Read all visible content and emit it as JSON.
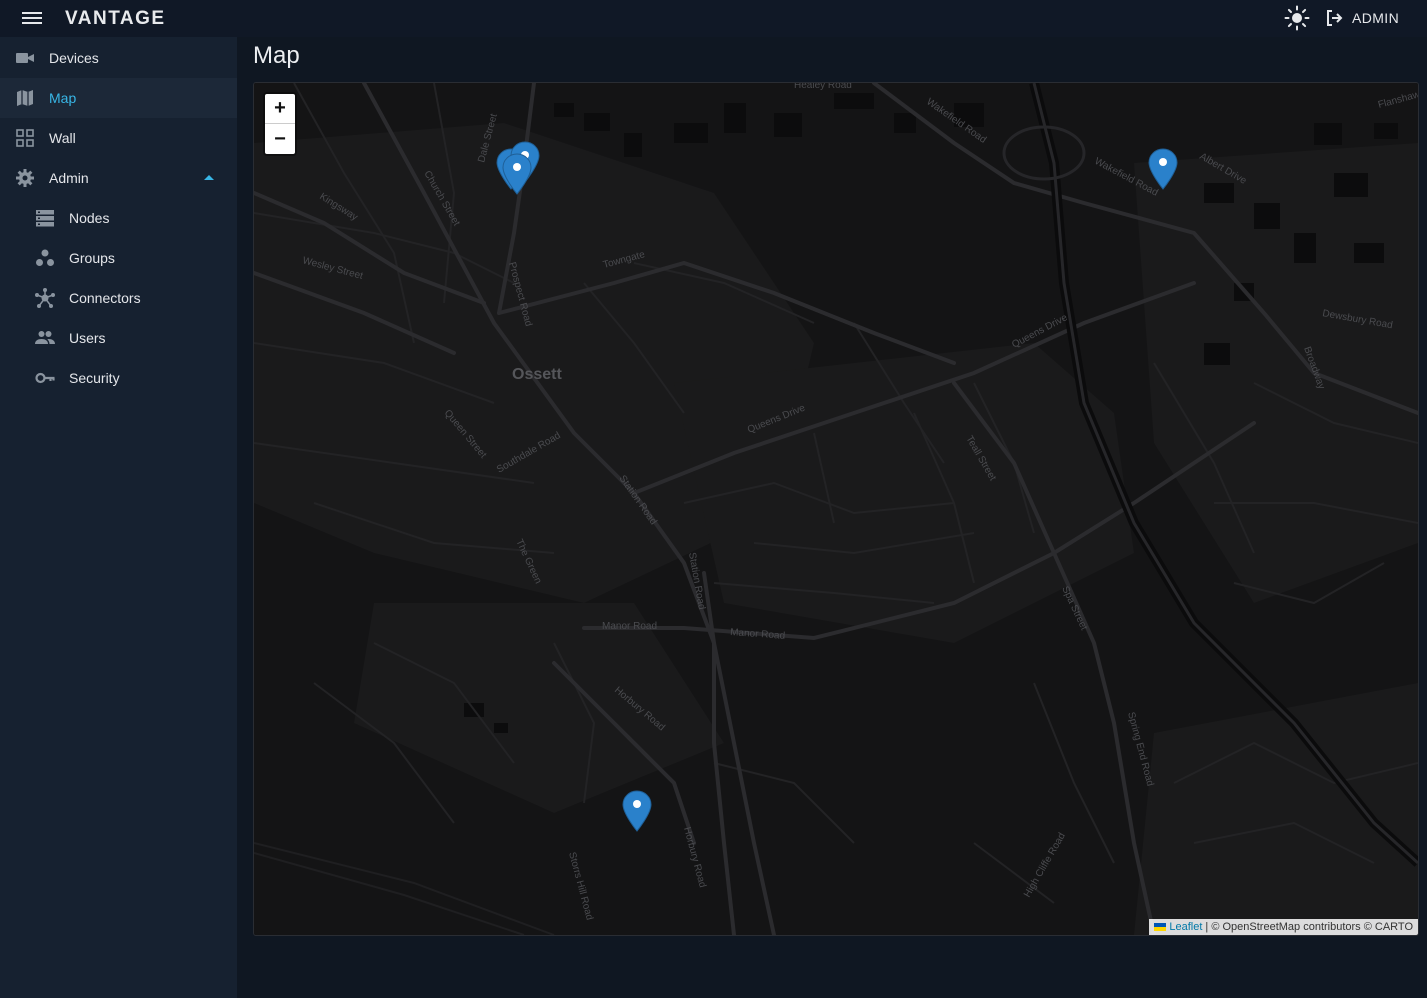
{
  "app": {
    "brand": "VANTAGE"
  },
  "header": {
    "user_label": "ADMIN"
  },
  "sidebar": {
    "items": [
      {
        "label": "Devices",
        "icon": "video-camera-icon"
      },
      {
        "label": "Map",
        "icon": "map-icon",
        "active": true
      },
      {
        "label": "Wall",
        "icon": "grid-icon"
      },
      {
        "label": "Admin",
        "icon": "gear-icon",
        "expanded": true
      },
      {
        "label": "Nodes",
        "icon": "server-icon"
      },
      {
        "label": "Groups",
        "icon": "group-nodes-icon"
      },
      {
        "label": "Connectors",
        "icon": "hub-icon"
      },
      {
        "label": "Users",
        "icon": "people-icon"
      },
      {
        "label": "Security",
        "icon": "key-icon"
      }
    ]
  },
  "page": {
    "title": "Map"
  },
  "map": {
    "zoom_in": "+",
    "zoom_out": "−",
    "place_label": "Ossett",
    "streets": [
      "Wakefield Road",
      "Queens Drive",
      "Station Road",
      "Manor Road",
      "Towngate",
      "Dewsbury Road",
      "Prospect Road",
      "Church Street",
      "Dale Street",
      "Kingsway",
      "Wesley Street",
      "Queen Street",
      "Southdale Road",
      "The Green",
      "Horbury Road",
      "Spa Street",
      "Spring End Road",
      "Teall Street",
      "Albert Drive",
      "Broadway",
      "Flanshaw",
      "Healey Road",
      "Storrs Hill Road",
      "High Cliffe Road"
    ],
    "attribution": {
      "link": "Leaflet",
      "text": "| © OpenStreetMap contributors © CARTO"
    }
  },
  "colors": {
    "accent": "#38b6e6",
    "marker": "#2a81cb"
  }
}
